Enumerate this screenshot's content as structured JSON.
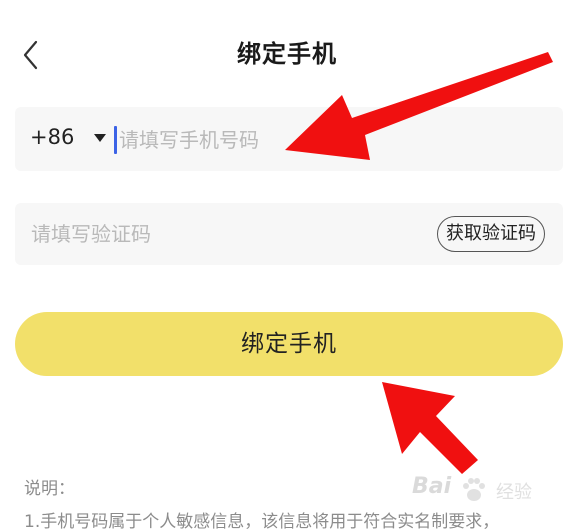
{
  "header": {
    "back_icon": "chevron-left-icon",
    "title": "绑定手机"
  },
  "phone_field": {
    "country_code": "+86",
    "country_caret_icon": "caret-down-icon",
    "placeholder": "请填写手机号码",
    "value": ""
  },
  "code_field": {
    "placeholder": "请填写验证码",
    "value": "",
    "get_code_label": "获取验证码"
  },
  "bind_button": {
    "label": "绑定手机"
  },
  "notes": {
    "title": "说明：",
    "line1": "1.手机号码属于个人敏感信息，该信息将用于符合实名制要求，"
  },
  "annotations": {
    "arrow_color": "#f01010",
    "arrow_icons": [
      "red-arrow-to-phone-field",
      "red-arrow-to-bind-button"
    ]
  },
  "watermark": {
    "text": "Bai",
    "sub": "经验"
  },
  "colors": {
    "accent_button": "#f2e06a",
    "field_background": "#f7f7f7",
    "placeholder": "#b9b9b9",
    "cursor": "#3c63e6"
  }
}
